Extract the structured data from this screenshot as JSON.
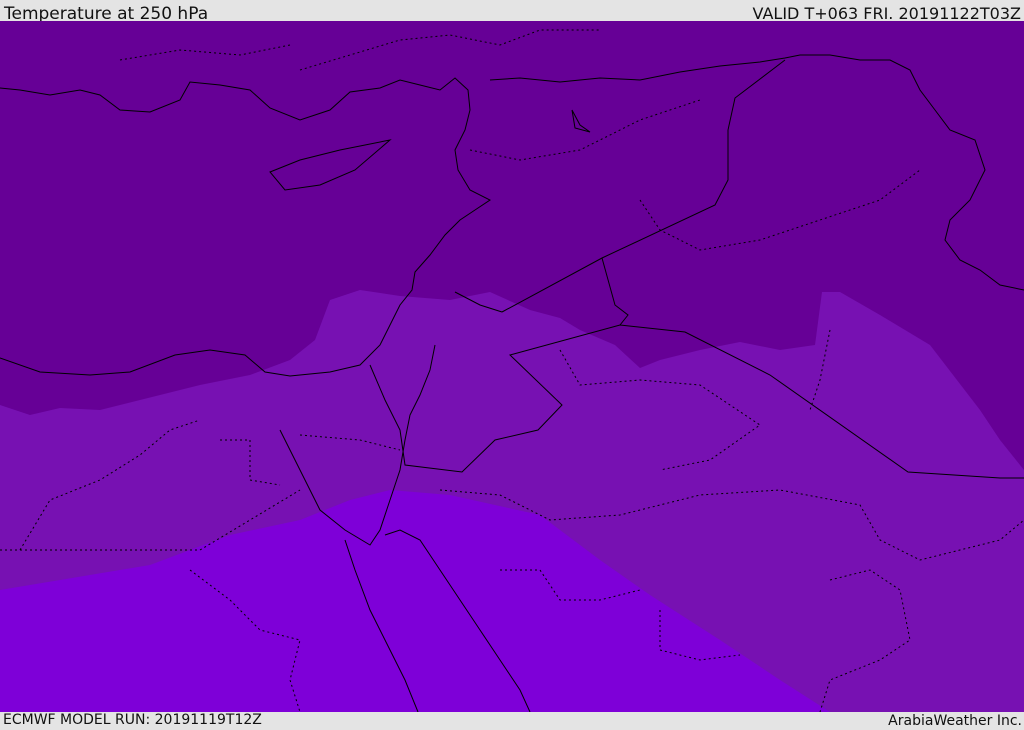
{
  "header": {
    "title": "Temperature at 250 hPa",
    "valid": "VALID T+063 FRI. 20191122T03Z"
  },
  "footer": {
    "model_run": "ECMWF MODEL RUN: 20191119T12Z",
    "credit": "ArabiaWeather Inc."
  },
  "colors": {
    "cold_band": "#660096",
    "mid_band": "#7711b2",
    "warm_band": "#7e00d8",
    "lines": "#000000"
  }
}
